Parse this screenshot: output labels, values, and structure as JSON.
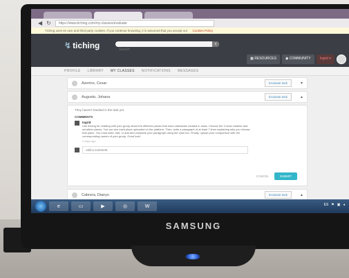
{
  "browser": {
    "url": "https://www.tiching.com/my-classes/evaluate",
    "notice": "Tiching uses its own and third party cookies. If you continue browsing, it is assumed that you accept our",
    "notice_link": "Cookies Policy"
  },
  "header": {
    "logo": "tiching",
    "search_placeholder": "Search",
    "nav": {
      "resources": "RESOURCES",
      "community": "COMMUNITY",
      "user": "Ingrid"
    }
  },
  "subnav": [
    "PROFILE",
    "LIBRARY",
    "MY CLASSES",
    "NOTIFICATIONS",
    "MESSAGES"
  ],
  "students": [
    {
      "name": "Azerino, Cesar",
      "button": "Evaluate task"
    },
    {
      "name": "Augusto, Johana",
      "button": "Evaluate task"
    }
  ],
  "detail": {
    "note": "They haven't handed in the task yet.",
    "comments_label": "COMMENTS",
    "comment": {
      "author": "Ingrid",
      "text": "Use tiching for chatting with your group about the different places that each classmate created in class. Choose the 3 most creative and sensitive places. You can see each place uploaded on the platform. Then, write a paragraph of at least 7 lines explaining why you choose that place. You must write, edit, or add and complete your paragraph using the chat box. Finally, upload your comparison with the corresponding names of your group. Good luck!",
      "date": "4 days ago"
    },
    "new_comment_placeholder": "Add a comment",
    "cancel": "CANCEL",
    "submit": "SUBMIT"
  },
  "next_student": {
    "name": "Cabrera, Dianys",
    "button": "Evaluate task"
  },
  "tray": {
    "lang": "ES"
  },
  "monitor": {
    "brand": "SAMSUNG"
  }
}
